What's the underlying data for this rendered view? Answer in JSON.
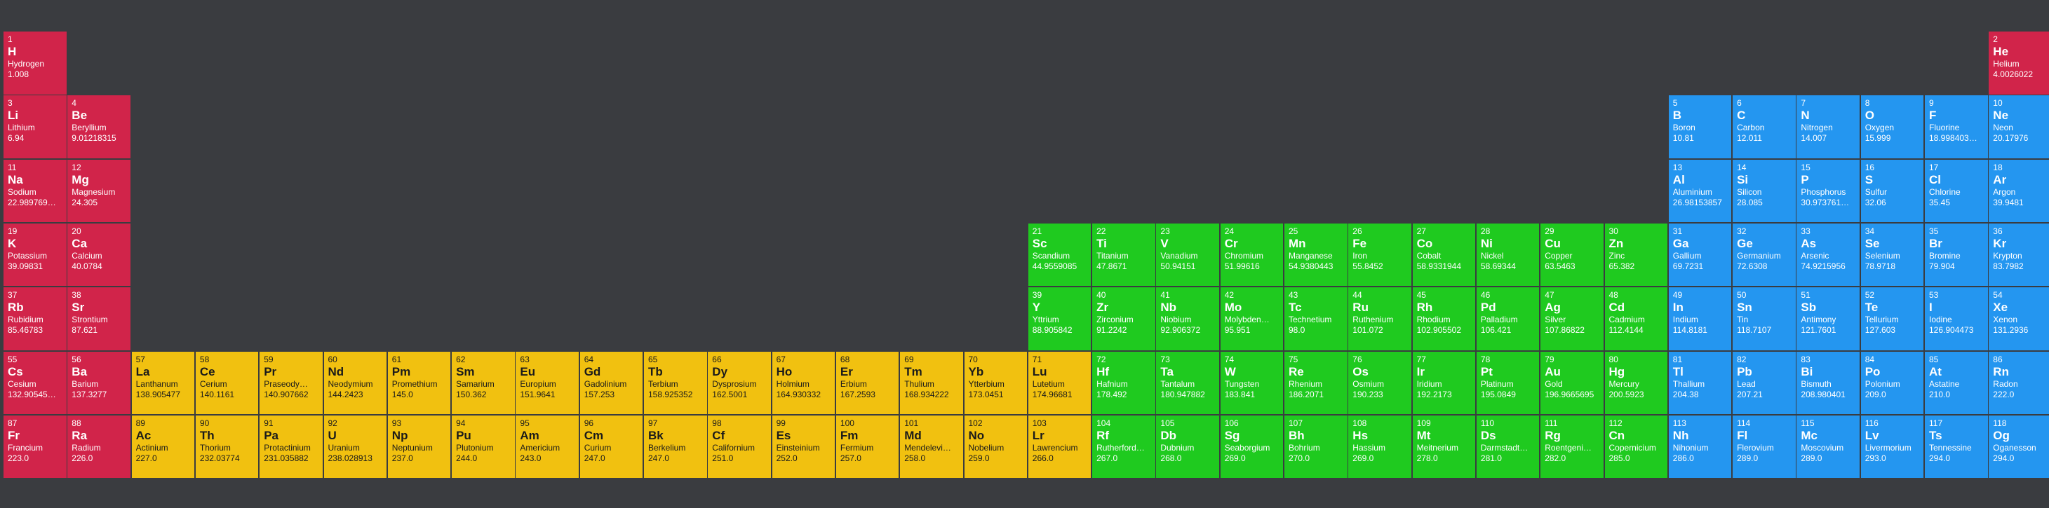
{
  "colors": {
    "background": "#3a3c40",
    "s_block": "#d1244a",
    "f_block": "#f1c110",
    "d_block": "#1fca1f",
    "p_block": "#2496f0"
  },
  "elements": [
    {
      "n": "1",
      "s": "H",
      "name": "Hydrogen",
      "m": "1.008",
      "r": 1,
      "c": 1,
      "b": "s"
    },
    {
      "n": "2",
      "s": "He",
      "name": "Helium",
      "m": "4.0026022",
      "r": 1,
      "c": 32,
      "b": "s"
    },
    {
      "n": "3",
      "s": "Li",
      "name": "Lithium",
      "m": "6.94",
      "r": 2,
      "c": 1,
      "b": "s"
    },
    {
      "n": "4",
      "s": "Be",
      "name": "Beryllium",
      "m": "9.01218315",
      "r": 2,
      "c": 2,
      "b": "s"
    },
    {
      "n": "5",
      "s": "B",
      "name": "Boron",
      "m": "10.81",
      "r": 2,
      "c": 27,
      "b": "p"
    },
    {
      "n": "6",
      "s": "C",
      "name": "Carbon",
      "m": "12.011",
      "r": 2,
      "c": 28,
      "b": "p"
    },
    {
      "n": "7",
      "s": "N",
      "name": "Nitrogen",
      "m": "14.007",
      "r": 2,
      "c": 29,
      "b": "p"
    },
    {
      "n": "8",
      "s": "O",
      "name": "Oxygen",
      "m": "15.999",
      "r": 2,
      "c": 30,
      "b": "p"
    },
    {
      "n": "9",
      "s": "F",
      "name": "Fluorine",
      "m": "18.998403…",
      "r": 2,
      "c": 31,
      "b": "p"
    },
    {
      "n": "10",
      "s": "Ne",
      "name": "Neon",
      "m": "20.17976",
      "r": 2,
      "c": 32,
      "b": "p"
    },
    {
      "n": "11",
      "s": "Na",
      "name": "Sodium",
      "m": "22.989769…",
      "r": 3,
      "c": 1,
      "b": "s"
    },
    {
      "n": "12",
      "s": "Mg",
      "name": "Magnesium",
      "m": "24.305",
      "r": 3,
      "c": 2,
      "b": "s"
    },
    {
      "n": "13",
      "s": "Al",
      "name": "Aluminium",
      "m": "26.98153857",
      "r": 3,
      "c": 27,
      "b": "p"
    },
    {
      "n": "14",
      "s": "Si",
      "name": "Silicon",
      "m": "28.085",
      "r": 3,
      "c": 28,
      "b": "p"
    },
    {
      "n": "15",
      "s": "P",
      "name": "Phosphorus",
      "m": "30.973761…",
      "r": 3,
      "c": 29,
      "b": "p"
    },
    {
      "n": "16",
      "s": "S",
      "name": "Sulfur",
      "m": "32.06",
      "r": 3,
      "c": 30,
      "b": "p"
    },
    {
      "n": "17",
      "s": "Cl",
      "name": "Chlorine",
      "m": "35.45",
      "r": 3,
      "c": 31,
      "b": "p"
    },
    {
      "n": "18",
      "s": "Ar",
      "name": "Argon",
      "m": "39.9481",
      "r": 3,
      "c": 32,
      "b": "p"
    },
    {
      "n": "19",
      "s": "K",
      "name": "Potassium",
      "m": "39.09831",
      "r": 4,
      "c": 1,
      "b": "s"
    },
    {
      "n": "20",
      "s": "Ca",
      "name": "Calcium",
      "m": "40.0784",
      "r": 4,
      "c": 2,
      "b": "s"
    },
    {
      "n": "21",
      "s": "Sc",
      "name": "Scandium",
      "m": "44.9559085",
      "r": 4,
      "c": 17,
      "b": "d"
    },
    {
      "n": "22",
      "s": "Ti",
      "name": "Titanium",
      "m": "47.8671",
      "r": 4,
      "c": 18,
      "b": "d"
    },
    {
      "n": "23",
      "s": "V",
      "name": "Vanadium",
      "m": "50.94151",
      "r": 4,
      "c": 19,
      "b": "d"
    },
    {
      "n": "24",
      "s": "Cr",
      "name": "Chromium",
      "m": "51.99616",
      "r": 4,
      "c": 20,
      "b": "d"
    },
    {
      "n": "25",
      "s": "Mn",
      "name": "Manganese",
      "m": "54.9380443",
      "r": 4,
      "c": 21,
      "b": "d"
    },
    {
      "n": "26",
      "s": "Fe",
      "name": "Iron",
      "m": "55.8452",
      "r": 4,
      "c": 22,
      "b": "d"
    },
    {
      "n": "27",
      "s": "Co",
      "name": "Cobalt",
      "m": "58.9331944",
      "r": 4,
      "c": 23,
      "b": "d"
    },
    {
      "n": "28",
      "s": "Ni",
      "name": "Nickel",
      "m": "58.69344",
      "r": 4,
      "c": 24,
      "b": "d"
    },
    {
      "n": "29",
      "s": "Cu",
      "name": "Copper",
      "m": "63.5463",
      "r": 4,
      "c": 25,
      "b": "d"
    },
    {
      "n": "30",
      "s": "Zn",
      "name": "Zinc",
      "m": "65.382",
      "r": 4,
      "c": 26,
      "b": "d"
    },
    {
      "n": "31",
      "s": "Ga",
      "name": "Gallium",
      "m": "69.7231",
      "r": 4,
      "c": 27,
      "b": "p"
    },
    {
      "n": "32",
      "s": "Ge",
      "name": "Germanium",
      "m": "72.6308",
      "r": 4,
      "c": 28,
      "b": "p"
    },
    {
      "n": "33",
      "s": "As",
      "name": "Arsenic",
      "m": "74.9215956",
      "r": 4,
      "c": 29,
      "b": "p"
    },
    {
      "n": "34",
      "s": "Se",
      "name": "Selenium",
      "m": "78.9718",
      "r": 4,
      "c": 30,
      "b": "p"
    },
    {
      "n": "35",
      "s": "Br",
      "name": "Bromine",
      "m": "79.904",
      "r": 4,
      "c": 31,
      "b": "p"
    },
    {
      "n": "36",
      "s": "Kr",
      "name": "Krypton",
      "m": "83.7982",
      "r": 4,
      "c": 32,
      "b": "p"
    },
    {
      "n": "37",
      "s": "Rb",
      "name": "Rubidium",
      "m": "85.46783",
      "r": 5,
      "c": 1,
      "b": "s"
    },
    {
      "n": "38",
      "s": "Sr",
      "name": "Strontium",
      "m": "87.621",
      "r": 5,
      "c": 2,
      "b": "s"
    },
    {
      "n": "39",
      "s": "Y",
      "name": "Yttrium",
      "m": "88.905842",
      "r": 5,
      "c": 17,
      "b": "d"
    },
    {
      "n": "40",
      "s": "Zr",
      "name": "Zirconium",
      "m": "91.2242",
      "r": 5,
      "c": 18,
      "b": "d"
    },
    {
      "n": "41",
      "s": "Nb",
      "name": "Niobium",
      "m": "92.906372",
      "r": 5,
      "c": 19,
      "b": "d"
    },
    {
      "n": "42",
      "s": "Mo",
      "name": "Molybden…",
      "m": "95.951",
      "r": 5,
      "c": 20,
      "b": "d"
    },
    {
      "n": "43",
      "s": "Tc",
      "name": "Technetium",
      "m": "98.0",
      "r": 5,
      "c": 21,
      "b": "d"
    },
    {
      "n": "44",
      "s": "Ru",
      "name": "Ruthenium",
      "m": "101.072",
      "r": 5,
      "c": 22,
      "b": "d"
    },
    {
      "n": "45",
      "s": "Rh",
      "name": "Rhodium",
      "m": "102.905502",
      "r": 5,
      "c": 23,
      "b": "d"
    },
    {
      "n": "46",
      "s": "Pd",
      "name": "Palladium",
      "m": "106.421",
      "r": 5,
      "c": 24,
      "b": "d"
    },
    {
      "n": "47",
      "s": "Ag",
      "name": "Silver",
      "m": "107.86822",
      "r": 5,
      "c": 25,
      "b": "d"
    },
    {
      "n": "48",
      "s": "Cd",
      "name": "Cadmium",
      "m": "112.4144",
      "r": 5,
      "c": 26,
      "b": "d"
    },
    {
      "n": "49",
      "s": "In",
      "name": "Indium",
      "m": "114.8181",
      "r": 5,
      "c": 27,
      "b": "p"
    },
    {
      "n": "50",
      "s": "Sn",
      "name": "Tin",
      "m": "118.7107",
      "r": 5,
      "c": 28,
      "b": "p"
    },
    {
      "n": "51",
      "s": "Sb",
      "name": "Antimony",
      "m": "121.7601",
      "r": 5,
      "c": 29,
      "b": "p"
    },
    {
      "n": "52",
      "s": "Te",
      "name": "Tellurium",
      "m": "127.603",
      "r": 5,
      "c": 30,
      "b": "p"
    },
    {
      "n": "53",
      "s": "I",
      "name": "Iodine",
      "m": "126.904473",
      "r": 5,
      "c": 31,
      "b": "p"
    },
    {
      "n": "54",
      "s": "Xe",
      "name": "Xenon",
      "m": "131.2936",
      "r": 5,
      "c": 32,
      "b": "p"
    },
    {
      "n": "55",
      "s": "Cs",
      "name": "Cesium",
      "m": "132.90545…",
      "r": 6,
      "c": 1,
      "b": "s"
    },
    {
      "n": "56",
      "s": "Ba",
      "name": "Barium",
      "m": "137.3277",
      "r": 6,
      "c": 2,
      "b": "s"
    },
    {
      "n": "57",
      "s": "La",
      "name": "Lanthanum",
      "m": "138.905477",
      "r": 6,
      "c": 3,
      "b": "f"
    },
    {
      "n": "58",
      "s": "Ce",
      "name": "Cerium",
      "m": "140.1161",
      "r": 6,
      "c": 4,
      "b": "f"
    },
    {
      "n": "59",
      "s": "Pr",
      "name": "Praseody…",
      "m": "140.907662",
      "r": 6,
      "c": 5,
      "b": "f"
    },
    {
      "n": "60",
      "s": "Nd",
      "name": "Neodymium",
      "m": "144.2423",
      "r": 6,
      "c": 6,
      "b": "f"
    },
    {
      "n": "61",
      "s": "Pm",
      "name": "Promethium",
      "m": "145.0",
      "r": 6,
      "c": 7,
      "b": "f"
    },
    {
      "n": "62",
      "s": "Sm",
      "name": "Samarium",
      "m": "150.362",
      "r": 6,
      "c": 8,
      "b": "f"
    },
    {
      "n": "63",
      "s": "Eu",
      "name": "Europium",
      "m": "151.9641",
      "r": 6,
      "c": 9,
      "b": "f"
    },
    {
      "n": "64",
      "s": "Gd",
      "name": "Gadolinium",
      "m": "157.253",
      "r": 6,
      "c": 10,
      "b": "f"
    },
    {
      "n": "65",
      "s": "Tb",
      "name": "Terbium",
      "m": "158.925352",
      "r": 6,
      "c": 11,
      "b": "f"
    },
    {
      "n": "66",
      "s": "Dy",
      "name": "Dysprosium",
      "m": "162.5001",
      "r": 6,
      "c": 12,
      "b": "f"
    },
    {
      "n": "67",
      "s": "Ho",
      "name": "Holmium",
      "m": "164.930332",
      "r": 6,
      "c": 13,
      "b": "f"
    },
    {
      "n": "68",
      "s": "Er",
      "name": "Erbium",
      "m": "167.2593",
      "r": 6,
      "c": 14,
      "b": "f"
    },
    {
      "n": "69",
      "s": "Tm",
      "name": "Thulium",
      "m": "168.934222",
      "r": 6,
      "c": 15,
      "b": "f"
    },
    {
      "n": "70",
      "s": "Yb",
      "name": "Ytterbium",
      "m": "173.0451",
      "r": 6,
      "c": 16,
      "b": "f"
    },
    {
      "n": "71",
      "s": "Lu",
      "name": "Lutetium",
      "m": "174.96681",
      "r": 6,
      "c": 17,
      "b": "f"
    },
    {
      "n": "72",
      "s": "Hf",
      "name": "Hafnium",
      "m": "178.492",
      "r": 6,
      "c": 18,
      "b": "d"
    },
    {
      "n": "73",
      "s": "Ta",
      "name": "Tantalum",
      "m": "180.947882",
      "r": 6,
      "c": 19,
      "b": "d"
    },
    {
      "n": "74",
      "s": "W",
      "name": "Tungsten",
      "m": "183.841",
      "r": 6,
      "c": 20,
      "b": "d"
    },
    {
      "n": "75",
      "s": "Re",
      "name": "Rhenium",
      "m": "186.2071",
      "r": 6,
      "c": 21,
      "b": "d"
    },
    {
      "n": "76",
      "s": "Os",
      "name": "Osmium",
      "m": "190.233",
      "r": 6,
      "c": 22,
      "b": "d"
    },
    {
      "n": "77",
      "s": "Ir",
      "name": "Iridium",
      "m": "192.2173",
      "r": 6,
      "c": 23,
      "b": "d"
    },
    {
      "n": "78",
      "s": "Pt",
      "name": "Platinum",
      "m": "195.0849",
      "r": 6,
      "c": 24,
      "b": "d"
    },
    {
      "n": "79",
      "s": "Au",
      "name": "Gold",
      "m": "196.9665695",
      "r": 6,
      "c": 25,
      "b": "d"
    },
    {
      "n": "80",
      "s": "Hg",
      "name": "Mercury",
      "m": "200.5923",
      "r": 6,
      "c": 26,
      "b": "d"
    },
    {
      "n": "81",
      "s": "Tl",
      "name": "Thallium",
      "m": "204.38",
      "r": 6,
      "c": 27,
      "b": "p"
    },
    {
      "n": "82",
      "s": "Pb",
      "name": "Lead",
      "m": "207.21",
      "r": 6,
      "c": 28,
      "b": "p"
    },
    {
      "n": "83",
      "s": "Bi",
      "name": "Bismuth",
      "m": "208.980401",
      "r": 6,
      "c": 29,
      "b": "p"
    },
    {
      "n": "84",
      "s": "Po",
      "name": "Polonium",
      "m": "209.0",
      "r": 6,
      "c": 30,
      "b": "p"
    },
    {
      "n": "85",
      "s": "At",
      "name": "Astatine",
      "m": "210.0",
      "r": 6,
      "c": 31,
      "b": "p"
    },
    {
      "n": "86",
      "s": "Rn",
      "name": "Radon",
      "m": "222.0",
      "r": 6,
      "c": 32,
      "b": "p"
    },
    {
      "n": "87",
      "s": "Fr",
      "name": "Francium",
      "m": "223.0",
      "r": 7,
      "c": 1,
      "b": "s"
    },
    {
      "n": "88",
      "s": "Ra",
      "name": "Radium",
      "m": "226.0",
      "r": 7,
      "c": 2,
      "b": "s"
    },
    {
      "n": "89",
      "s": "Ac",
      "name": "Actinium",
      "m": "227.0",
      "r": 7,
      "c": 3,
      "b": "f"
    },
    {
      "n": "90",
      "s": "Th",
      "name": "Thorium",
      "m": "232.03774",
      "r": 7,
      "c": 4,
      "b": "f"
    },
    {
      "n": "91",
      "s": "Pa",
      "name": "Protactinium",
      "m": "231.035882",
      "r": 7,
      "c": 5,
      "b": "f"
    },
    {
      "n": "92",
      "s": "U",
      "name": "Uranium",
      "m": "238.028913",
      "r": 7,
      "c": 6,
      "b": "f"
    },
    {
      "n": "93",
      "s": "Np",
      "name": "Neptunium",
      "m": "237.0",
      "r": 7,
      "c": 7,
      "b": "f"
    },
    {
      "n": "94",
      "s": "Pu",
      "name": "Plutonium",
      "m": "244.0",
      "r": 7,
      "c": 8,
      "b": "f"
    },
    {
      "n": "95",
      "s": "Am",
      "name": "Americium",
      "m": "243.0",
      "r": 7,
      "c": 9,
      "b": "f"
    },
    {
      "n": "96",
      "s": "Cm",
      "name": "Curium",
      "m": "247.0",
      "r": 7,
      "c": 10,
      "b": "f"
    },
    {
      "n": "97",
      "s": "Bk",
      "name": "Berkelium",
      "m": "247.0",
      "r": 7,
      "c": 11,
      "b": "f"
    },
    {
      "n": "98",
      "s": "Cf",
      "name": "Californium",
      "m": "251.0",
      "r": 7,
      "c": 12,
      "b": "f"
    },
    {
      "n": "99",
      "s": "Es",
      "name": "Einsteinium",
      "m": "252.0",
      "r": 7,
      "c": 13,
      "b": "f"
    },
    {
      "n": "100",
      "s": "Fm",
      "name": "Fermium",
      "m": "257.0",
      "r": 7,
      "c": 14,
      "b": "f"
    },
    {
      "n": "101",
      "s": "Md",
      "name": "Mendelevi…",
      "m": "258.0",
      "r": 7,
      "c": 15,
      "b": "f"
    },
    {
      "n": "102",
      "s": "No",
      "name": "Nobelium",
      "m": "259.0",
      "r": 7,
      "c": 16,
      "b": "f"
    },
    {
      "n": "103",
      "s": "Lr",
      "name": "Lawrencium",
      "m": "266.0",
      "r": 7,
      "c": 17,
      "b": "f"
    },
    {
      "n": "104",
      "s": "Rf",
      "name": "Rutherford…",
      "m": "267.0",
      "r": 7,
      "c": 18,
      "b": "d"
    },
    {
      "n": "105",
      "s": "Db",
      "name": "Dubnium",
      "m": "268.0",
      "r": 7,
      "c": 19,
      "b": "d"
    },
    {
      "n": "106",
      "s": "Sg",
      "name": "Seaborgium",
      "m": "269.0",
      "r": 7,
      "c": 20,
      "b": "d"
    },
    {
      "n": "107",
      "s": "Bh",
      "name": "Bohrium",
      "m": "270.0",
      "r": 7,
      "c": 21,
      "b": "d"
    },
    {
      "n": "108",
      "s": "Hs",
      "name": "Hassium",
      "m": "269.0",
      "r": 7,
      "c": 22,
      "b": "d"
    },
    {
      "n": "109",
      "s": "Mt",
      "name": "Meitnerium",
      "m": "278.0",
      "r": 7,
      "c": 23,
      "b": "d"
    },
    {
      "n": "110",
      "s": "Ds",
      "name": "Darmstadt…",
      "m": "281.0",
      "r": 7,
      "c": 24,
      "b": "d"
    },
    {
      "n": "111",
      "s": "Rg",
      "name": "Roentgeni…",
      "m": "282.0",
      "r": 7,
      "c": 25,
      "b": "d"
    },
    {
      "n": "112",
      "s": "Cn",
      "name": "Copernicium",
      "m": "285.0",
      "r": 7,
      "c": 26,
      "b": "d"
    },
    {
      "n": "113",
      "s": "Nh",
      "name": "Nihonium",
      "m": "286.0",
      "r": 7,
      "c": 27,
      "b": "p"
    },
    {
      "n": "114",
      "s": "Fl",
      "name": "Flerovium",
      "m": "289.0",
      "r": 7,
      "c": 28,
      "b": "p"
    },
    {
      "n": "115",
      "s": "Mc",
      "name": "Moscovium",
      "m": "289.0",
      "r": 7,
      "c": 29,
      "b": "p"
    },
    {
      "n": "116",
      "s": "Lv",
      "name": "Livermorium",
      "m": "293.0",
      "r": 7,
      "c": 30,
      "b": "p"
    },
    {
      "n": "117",
      "s": "Ts",
      "name": "Tennessine",
      "m": "294.0",
      "r": 7,
      "c": 31,
      "b": "p"
    },
    {
      "n": "118",
      "s": "Og",
      "name": "Oganesson",
      "m": "294.0",
      "r": 7,
      "c": 32,
      "b": "p"
    }
  ]
}
